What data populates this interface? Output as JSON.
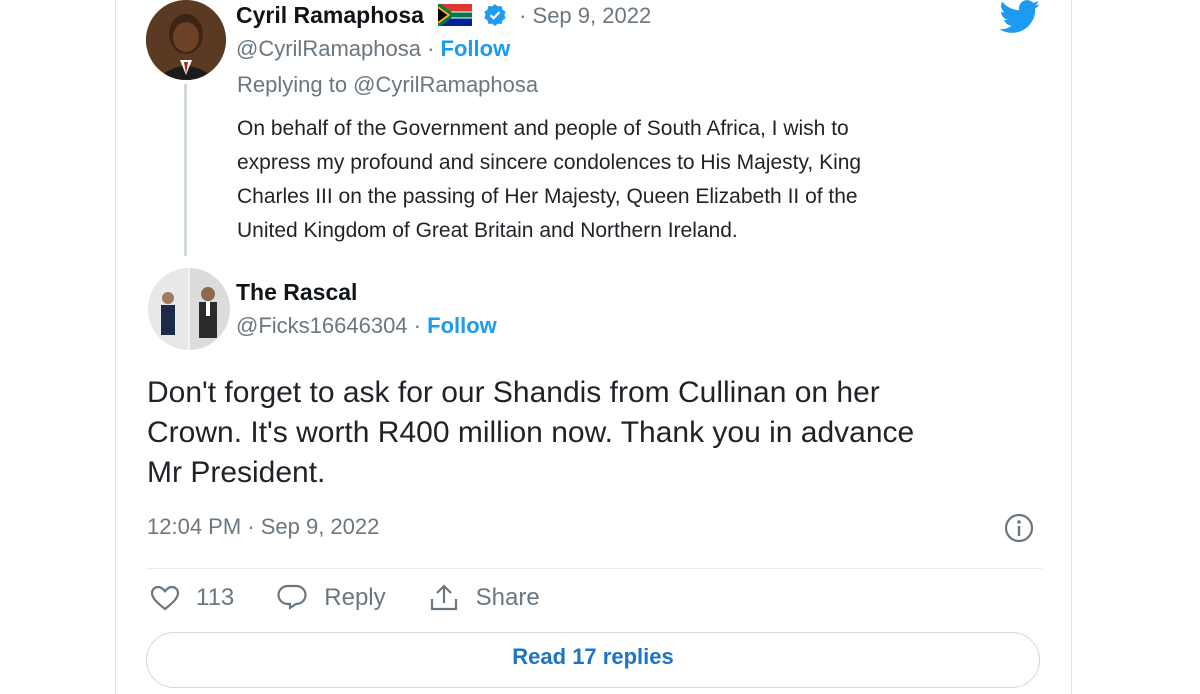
{
  "original_tweet": {
    "author_name": "Cyril Ramaphosa",
    "separator_date": "· Sep 9, 2022",
    "handle": "@CyrilRamaphosa",
    "follow_sep": "·",
    "follow_label": "Follow",
    "replying_to": "Replying to @CyrilRamaphosa",
    "body_lines": [
      "On behalf of the Government and people of South Africa, I wish to",
      "express my profound and sincere condolences to His Majesty, King",
      "Charles III on the passing of Her Majesty, Queen Elizabeth II of the",
      "United Kingdom of Great Britain and Northern Ireland."
    ]
  },
  "reply_tweet": {
    "author_name": "The Rascal",
    "handle": "@Ficks16646304",
    "follow_sep": "·",
    "follow_label": "Follow",
    "body_lines": [
      "Don't forget to ask for our Shandis from Cullinan on her",
      "Crown. It's worth R400 million now. Thank you  in advance",
      "Mr President."
    ],
    "timestamp": "12:04 PM · Sep 9, 2022"
  },
  "actions": {
    "like_count": "113",
    "reply_label": "Reply",
    "share_label": "Share"
  },
  "read_replies_label": "Read 17 replies",
  "icons": [
    "twitter-bird-icon",
    "verified-badge-icon",
    "south-africa-flag-icon",
    "heart-icon",
    "comment-icon",
    "share-icon",
    "info-icon"
  ],
  "colors": {
    "accent": "#1d9bf0",
    "text": "#0f1419",
    "muted": "#6b7780",
    "border": "#cfd9de"
  }
}
